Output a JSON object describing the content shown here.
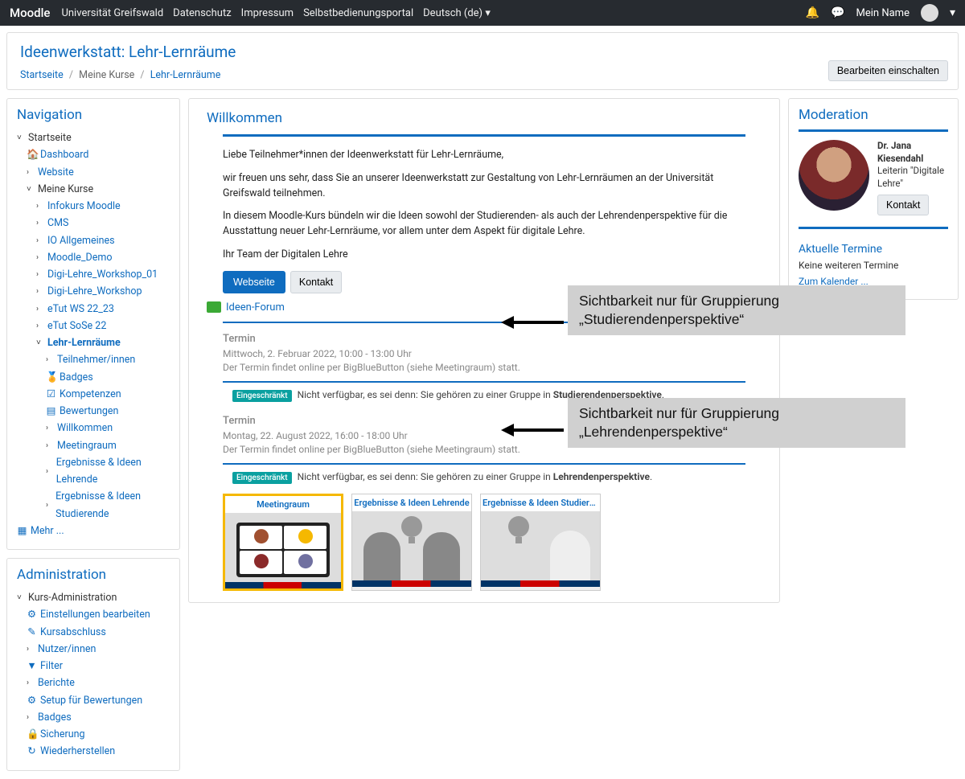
{
  "topbar": {
    "brand": "Moodle",
    "links": [
      "Universität Greifswald",
      "Datenschutz",
      "Impressum",
      "Selbstbedienungsportal",
      "Deutsch (de)"
    ],
    "username": "Mein Name"
  },
  "header": {
    "title": "Ideenwerkstatt: Lehr-Lernräume",
    "breadcrumb": [
      "Startseite",
      "Meine Kurse",
      "Lehr-Lernräume"
    ],
    "edit_button": "Bearbeiten einschalten"
  },
  "navigation": {
    "title": "Navigation",
    "items": [
      {
        "label": "Startseite",
        "caret": "v",
        "indent": 0,
        "bold": false,
        "icon": ""
      },
      {
        "label": "Dashboard",
        "caret": "",
        "indent": 1,
        "bold": false,
        "icon": "🏠"
      },
      {
        "label": "Website",
        "caret": ">",
        "indent": 1,
        "bold": false,
        "icon": ""
      },
      {
        "label": "Meine Kurse",
        "caret": "v",
        "indent": 1,
        "bold": false,
        "icon": ""
      },
      {
        "label": "Infokurs Moodle",
        "caret": ">",
        "indent": 2,
        "bold": false,
        "icon": ""
      },
      {
        "label": "CMS",
        "caret": ">",
        "indent": 2,
        "bold": false,
        "icon": ""
      },
      {
        "label": "IO Allgemeines",
        "caret": ">",
        "indent": 2,
        "bold": false,
        "icon": ""
      },
      {
        "label": "Moodle_Demo",
        "caret": ">",
        "indent": 2,
        "bold": false,
        "icon": ""
      },
      {
        "label": "Digi-Lehre_Workshop_01",
        "caret": ">",
        "indent": 2,
        "bold": false,
        "icon": ""
      },
      {
        "label": "Digi-Lehre_Workshop",
        "caret": ">",
        "indent": 2,
        "bold": false,
        "icon": ""
      },
      {
        "label": "eTut WS 22_23",
        "caret": ">",
        "indent": 2,
        "bold": false,
        "icon": ""
      },
      {
        "label": "eTut SoSe 22",
        "caret": ">",
        "indent": 2,
        "bold": false,
        "icon": ""
      },
      {
        "label": "Lehr-Lernräume",
        "caret": "v",
        "indent": 2,
        "bold": true,
        "icon": ""
      },
      {
        "label": "Teilnehmer/innen",
        "caret": ">",
        "indent": 3,
        "bold": false,
        "icon": ""
      },
      {
        "label": "Badges",
        "caret": "",
        "indent": 3,
        "bold": false,
        "icon": "🏅"
      },
      {
        "label": "Kompetenzen",
        "caret": "",
        "indent": 3,
        "bold": false,
        "icon": "☑"
      },
      {
        "label": "Bewertungen",
        "caret": "",
        "indent": 3,
        "bold": false,
        "icon": "▤"
      },
      {
        "label": "Willkommen",
        "caret": ">",
        "indent": 3,
        "bold": false,
        "icon": ""
      },
      {
        "label": "Meetingraum",
        "caret": ">",
        "indent": 3,
        "bold": false,
        "icon": ""
      },
      {
        "label": "Ergebnisse & Ideen Lehrende",
        "caret": ">",
        "indent": 3,
        "bold": false,
        "icon": ""
      },
      {
        "label": "Ergebnisse & Ideen Studierende",
        "caret": ">",
        "indent": 3,
        "bold": false,
        "icon": ""
      }
    ],
    "more": "Mehr ..."
  },
  "administration": {
    "title": "Administration",
    "root": "Kurs-Administration",
    "items": [
      {
        "label": "Einstellungen bearbeiten",
        "icon": "⚙"
      },
      {
        "label": "Kursabschluss",
        "icon": "✎"
      },
      {
        "label": "Nutzer/innen",
        "icon": ">"
      },
      {
        "label": "Filter",
        "icon": "▼"
      },
      {
        "label": "Berichte",
        "icon": ">"
      },
      {
        "label": "Setup für Bewertungen",
        "icon": "⚙"
      },
      {
        "label": "Badges",
        "icon": ">"
      },
      {
        "label": "Sicherung",
        "icon": "🔒"
      },
      {
        "label": "Wiederherstellen",
        "icon": "↻"
      }
    ]
  },
  "main": {
    "welcome_title": "Willkommen",
    "p1": "Liebe Teilnehmer*innen der Ideenwerkstatt für Lehr-Lernräume,",
    "p2": "wir freuen uns sehr, dass Sie an unserer Ideenwerkstatt zur Gestaltung von Lehr-Lernräumen an der Universität Greifswald teilnehmen.",
    "p3": "In diesem Moodle-Kurs bündeln wir die Ideen sowohl der Studierenden- als auch der Lehrendenperspektive für die Ausstattung neuer Lehr-Lernräume, vor allem unter dem Aspekt für digitale Lehre.",
    "p4": "Ihr Team der Digitalen Lehre",
    "btn_webseite": "Webseite",
    "btn_kontakt": "Kontakt",
    "forum_label": "Ideen-Forum",
    "section1": {
      "title": "Termin",
      "date": "Mittwoch, 2. Februar 2022, 10:00 - 13:00 Uhr",
      "desc": "Der Termin findet online per BigBlueButton (siehe Meetingraum) statt.",
      "restrict_badge": "Eingeschränkt",
      "restrict_text_pre": "Nicht verfügbar, es sei denn: Sie gehören zu einer Gruppe in ",
      "restrict_group": "Studierendenperspektive"
    },
    "section2": {
      "title": "Termin",
      "date": "Montag, 22. August 2022, 16:00 - 18:00 Uhr",
      "desc": "Der Termin findet online per BigBlueButton (siehe Meetingraum) statt.",
      "restrict_badge": "Eingeschränkt",
      "restrict_text_pre": "Nicht verfügbar, es sei denn: Sie gehören zu einer Gruppe in ",
      "restrict_group": "Lehrendenperspektive"
    },
    "cards": [
      "Meetingraum",
      "Ergebnisse & Ideen Lehrende",
      "Ergebnisse & Ideen Studiere..."
    ]
  },
  "moderation": {
    "title": "Moderation",
    "name": "Dr. Jana Kiesendahl",
    "role": "Leiterin \"Digitale Lehre\"",
    "contact_btn": "Kontakt",
    "cal_title": "Aktuelle Termine",
    "cal_none": "Keine weiteren Termine",
    "cal_link": "Zum Kalender ..."
  },
  "annotations": {
    "a1_l1": "Sichtbarkeit nur für Gruppierung",
    "a1_l2": "„Studierendenperspektive“",
    "a2_l1": "Sichtbarkeit nur für Gruppierung",
    "a2_l2": "„Lehrendenperspektive“"
  }
}
